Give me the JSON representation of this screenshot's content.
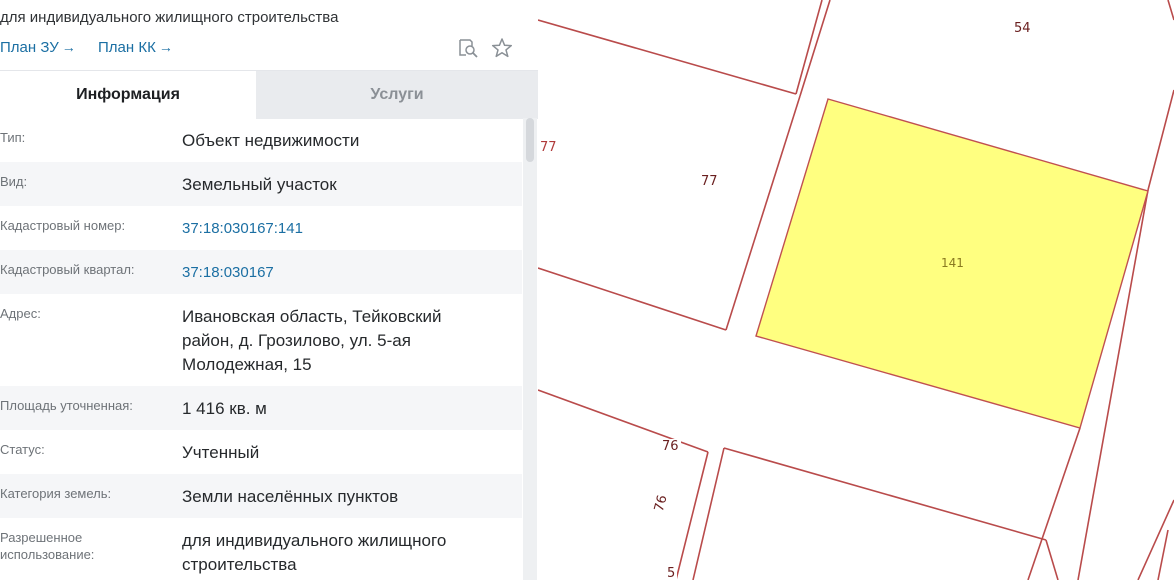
{
  "header": {
    "purpose_text": "для индивидуального жилищного строительства",
    "plan_zu": "План ЗУ",
    "plan_kk": "План КК",
    "link_arrow": "→"
  },
  "tabs": {
    "info": "Информация",
    "services": "Услуги"
  },
  "details": [
    {
      "label": "Тип:",
      "value": "Объект недвижимости"
    },
    {
      "label": "Вид:",
      "value": "Земельный участок"
    },
    {
      "label": "Кадастровый номер:",
      "value": "37:18:030167:141"
    },
    {
      "label": "Кадастровый квартал:",
      "value": "37:18:030167"
    },
    {
      "label": "Адрес:",
      "value": "Ивановская область, Тейковский район, д. Грозилово, ул. 5-ая Молодежная, 15"
    },
    {
      "label": "Площадь уточненная:",
      "value": "1 416 кв. м"
    },
    {
      "label": "Статус:",
      "value": "Учтенный"
    },
    {
      "label": "Категория земель:",
      "value": "Земли населённых пунктов"
    },
    {
      "label": "Разрешенное использование:",
      "value": "для индивидуального жилищного строительства"
    }
  ],
  "map": {
    "labels": {
      "n54": "54",
      "n77_edge": "77",
      "n77": "77",
      "n141": "141",
      "n76_a": "76",
      "n76_b": "76",
      "n5": "5"
    },
    "colors": {
      "parcel_fill": "#ffff80",
      "parcel_stroke": "#c05050",
      "boundary": "#b94b4b",
      "link": "#1b6fa3"
    }
  }
}
